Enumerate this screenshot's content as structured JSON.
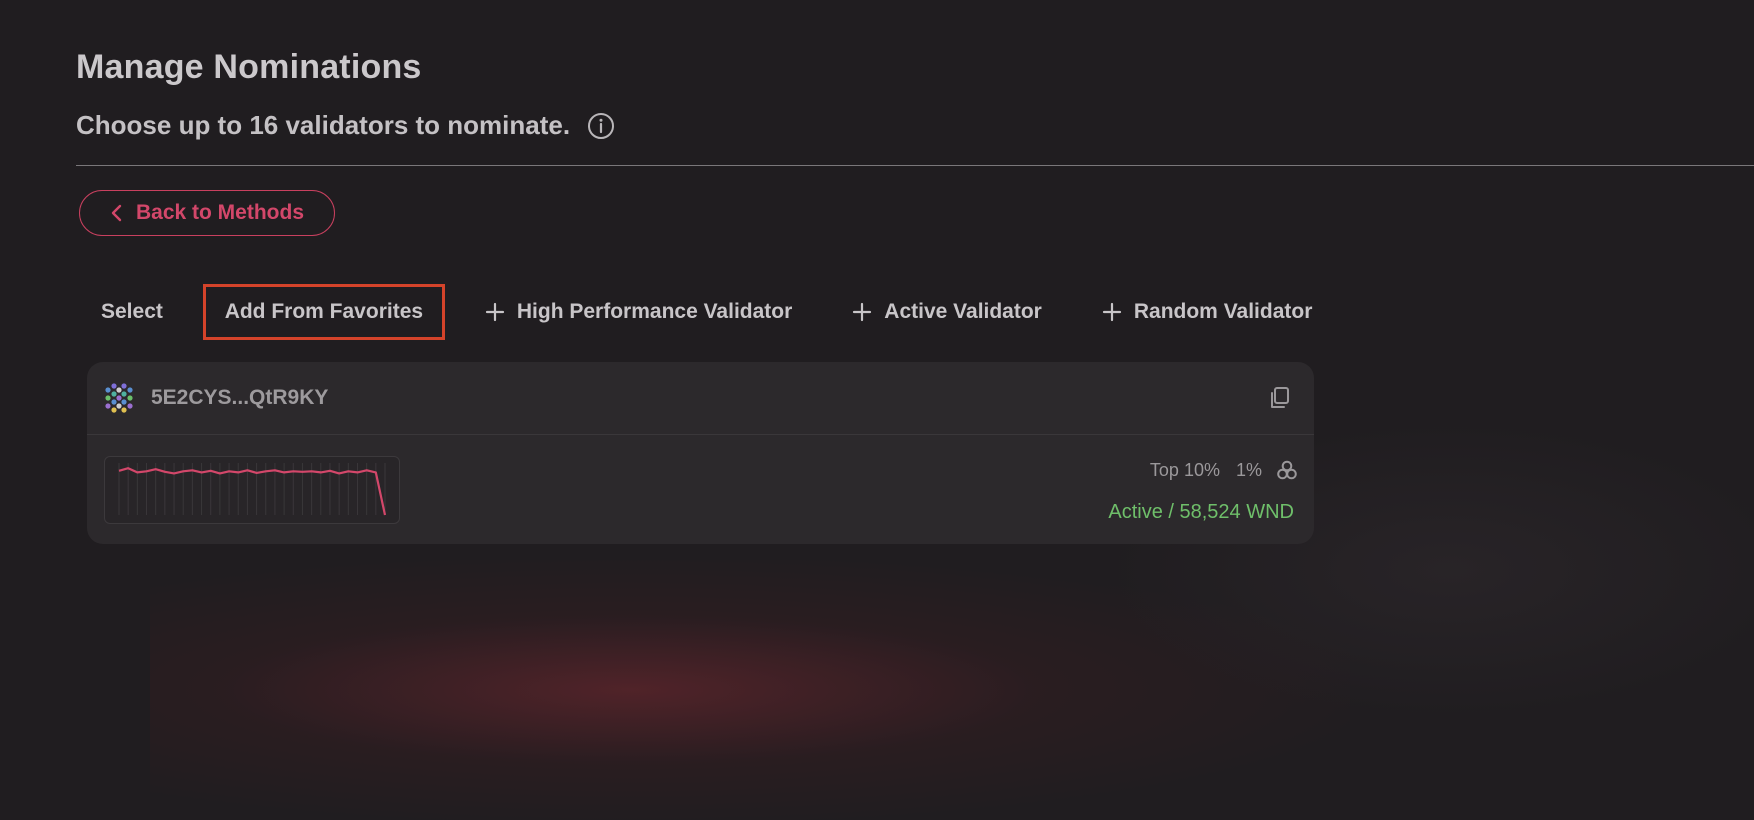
{
  "header": {
    "title": "Manage Nominations",
    "subtitle": "Choose up to 16 validators to nominate."
  },
  "back_button": {
    "label": "Back to Methods"
  },
  "toolbar": {
    "select_label": "Select",
    "add_favorites_label": "Add From Favorites",
    "high_performance_label": "High Performance Validator",
    "active_label": "Active Validator",
    "random_label": "Random Validator"
  },
  "validator": {
    "address": "5E2CYS...QtR9KY",
    "rank": "Top 10%",
    "commission": "1%",
    "status": "Active / 58,524 WND",
    "performance_series": [
      0.85,
      0.9,
      0.82,
      0.84,
      0.88,
      0.83,
      0.8,
      0.84,
      0.86,
      0.82,
      0.85,
      0.8,
      0.84,
      0.82,
      0.86,
      0.81,
      0.84,
      0.86,
      0.82,
      0.84,
      0.83,
      0.84,
      0.82,
      0.85,
      0.8,
      0.84,
      0.82,
      0.86,
      0.82,
      0.0
    ]
  },
  "colors": {
    "accent": "#d3476a",
    "status_active": "#6fbf6a",
    "highlight_box": "#d4432a",
    "background": "#201d20",
    "card": "#2c292c"
  },
  "icons": {
    "info": "info-icon",
    "back": "chevron-left-icon",
    "plus": "plus-icon",
    "copy": "copy-icon",
    "identicon": "identicon",
    "stack": "stack-icon"
  }
}
